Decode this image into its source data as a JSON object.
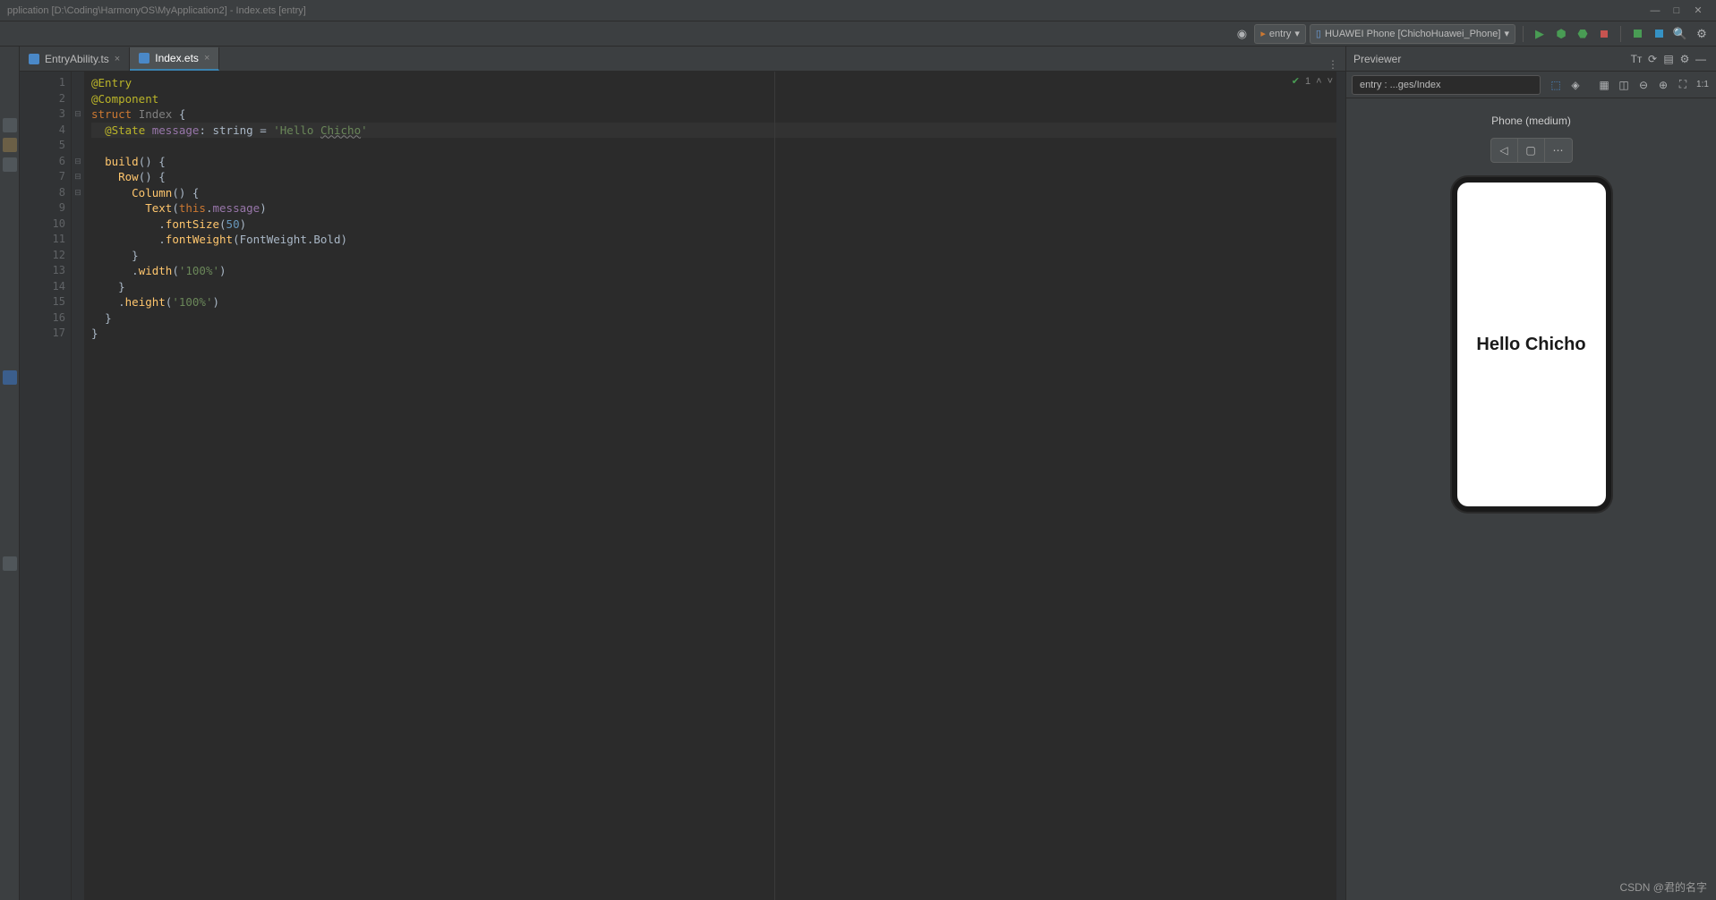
{
  "titlebar": {
    "title": "pplication [D:\\Coding\\HarmonyOS\\MyApplication2] - Index.ets [entry]"
  },
  "toolbar": {
    "module_dropdown": "entry",
    "device_dropdown": "HUAWEI Phone [ChichoHuawei_Phone]"
  },
  "tabs": [
    {
      "label": "EntryAbility.ts",
      "active": false
    },
    {
      "label": "Index.ets",
      "active": true
    }
  ],
  "editor": {
    "status_count": "1",
    "lines": [
      1,
      2,
      3,
      4,
      5,
      6,
      7,
      8,
      9,
      10,
      11,
      12,
      13,
      14,
      15,
      16,
      17
    ],
    "code": {
      "l1_deco": "@Entry",
      "l2_deco": "@Component",
      "l3_kw": "struct",
      "l3_id": "Index",
      "l3_brace": "{",
      "l4_deco": "@State",
      "l4_prop": "message",
      "l4_colon": ":",
      "l4_type": "string",
      "l4_eq": "=",
      "l4_str_open": "'Hello ",
      "l4_str_u": "Chicho",
      "l4_str_close": "'",
      "l6_fn": "build",
      "l6_rest": "() {",
      "l7_fn": "Row",
      "l7_rest": "() {",
      "l8_fn": "Column",
      "l8_rest": "() {",
      "l9_fn": "Text",
      "l9_open": "(",
      "l9_this": "this",
      "l9_dot": ".",
      "l9_msg": "message",
      "l9_close": ")",
      "l10_dot": ".",
      "l10_fn": "fontSize",
      "l10_open": "(",
      "l10_num": "50",
      "l10_close": ")",
      "l11_dot": ".",
      "l11_fn": "fontWeight",
      "l11_open": "(",
      "l11_arg": "FontWeight.Bold",
      "l11_close": ")",
      "l12": "}",
      "l13_dot": ".",
      "l13_fn": "width",
      "l13_open": "(",
      "l13_str": "'100%'",
      "l13_close": ")",
      "l14": "}",
      "l15_dot": ".",
      "l15_fn": "height",
      "l15_open": "(",
      "l15_str": "'100%'",
      "l15_close": ")",
      "l16": "}",
      "l17": "}"
    }
  },
  "previewer": {
    "title": "Previewer",
    "crumb": "entry : ...ges/Index",
    "device_label": "Phone (medium)",
    "preview_text": "Hello Chicho"
  },
  "watermark": "CSDN @君的名字"
}
